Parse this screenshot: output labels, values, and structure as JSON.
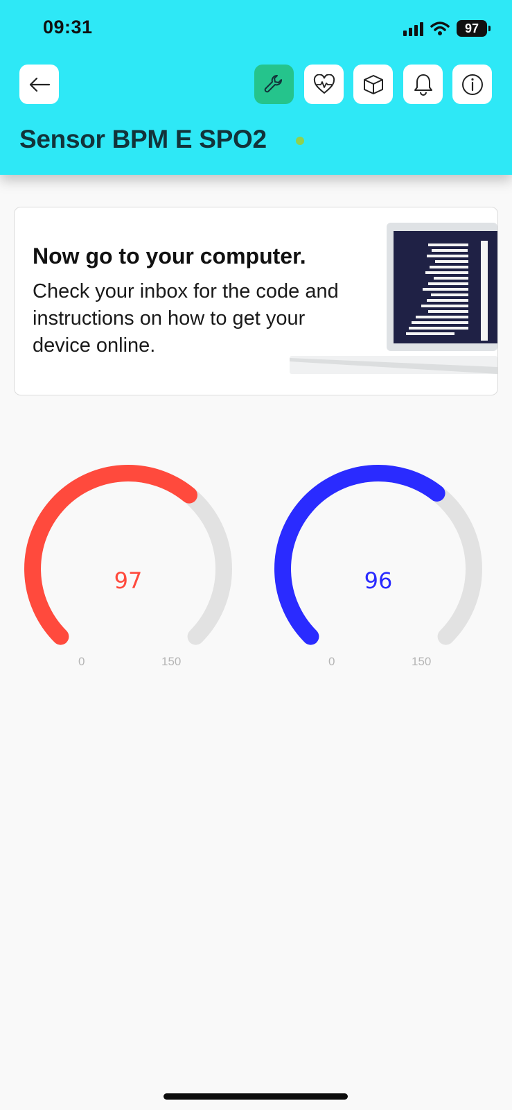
{
  "status_bar": {
    "time": "09:31",
    "battery": "97",
    "icons": [
      "signal-icon",
      "wifi-icon",
      "battery-icon"
    ]
  },
  "header": {
    "background": "#2ee8f6",
    "title": "Sensor BPM E SPO2",
    "online": true,
    "buttons": [
      {
        "icon": "back-arrow-icon"
      },
      {
        "icon": "wrench-icon",
        "active": true
      },
      {
        "icon": "heart-pulse-icon"
      },
      {
        "icon": "cube-icon"
      },
      {
        "icon": "bell-icon"
      },
      {
        "icon": "info-icon"
      }
    ]
  },
  "banner": {
    "heading": "Now go to your computer.",
    "body": "Check your inbox for the code and instructions on how to get your device online.",
    "illustration": "laptop-code-illustration"
  },
  "gauges": [
    {
      "value": 97,
      "label": "97",
      "min_label": "0",
      "max_label": "150",
      "min": 0,
      "max": 150,
      "color": "#ff4a3d"
    },
    {
      "value": 96,
      "label": "96",
      "min_label": "0",
      "max_label": "150",
      "min": 0,
      "max": 150,
      "color": "#2a2bff"
    }
  ],
  "colors": {
    "accent_active": "#25c48c",
    "gauge_track": "#e2e2e2",
    "online_dot": "#8fd14f"
  }
}
